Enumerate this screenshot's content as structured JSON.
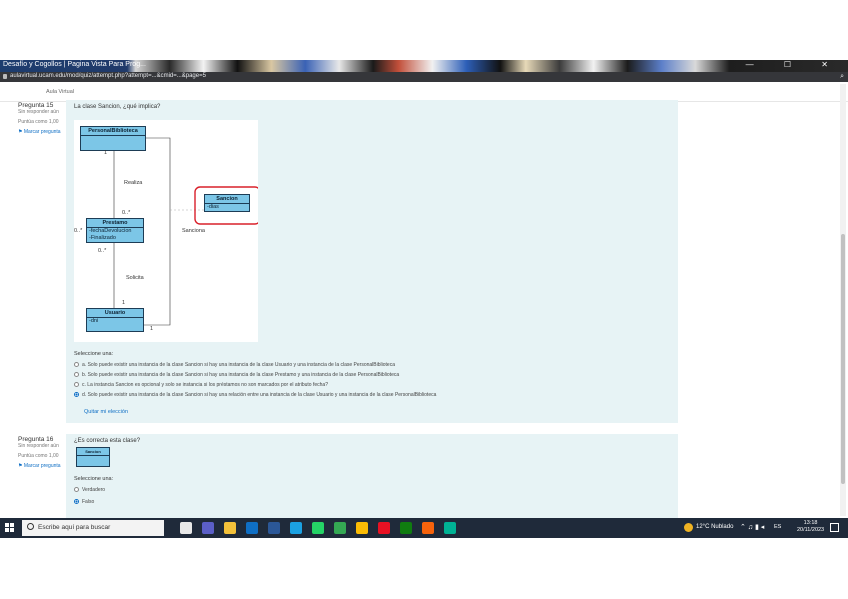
{
  "browser": {
    "tab_title": "Desafío y Cogollos | Pagina Vista Para Prog...",
    "window_controls": "— ☐ ✕",
    "url": "aulavirtual.ucam.edu/mod/quiz/attempt.php?attempt=...&cmid=...&page=5",
    "search_glyph": "⌕"
  },
  "page": {
    "header_link": "Aula Virtual"
  },
  "q15": {
    "number": "Pregunta 15",
    "status": "Sin responder aún",
    "points": "Puntúa como 1,00",
    "flag": "Marcar pregunta",
    "question": "La clase Sancion, ¿qué implica?",
    "uml": {
      "personal": {
        "title": "PersonalBiblioteca"
      },
      "prestamo": {
        "title": "Prestamo",
        "attrs": [
          "-fechaDevolucion",
          "-Finalizado"
        ]
      },
      "sancion": {
        "title": "Sancion",
        "attrs": [
          "-dias"
        ]
      },
      "usuario": {
        "title": "Usuario",
        "attrs": [
          "-dni"
        ]
      },
      "labels": {
        "realiza": "Realiza",
        "sanciona": "Sanciona",
        "solicita": "Solicita",
        "m1": "1",
        "m0n_a": "0..*",
        "m0n_b": "0..*",
        "m1_b": "1",
        "m1_c": "1",
        "m0n_c": "0..*"
      },
      "highlight_color": "#d9202a"
    },
    "select_one": "Seleccione una:",
    "options": [
      {
        "letter": "a.",
        "text": "Solo puede existir una instancia de la clase Sancion si hay una instancia de la clase Usuario y una instancia de la clase PersonalBiblioteca",
        "checked": false
      },
      {
        "letter": "b.",
        "text": "Solo puede existir una instancia de la clase Sancion si hay una instancia de la clase Prestamo y una instancia de la clase PersonalBiblioteca",
        "checked": false
      },
      {
        "letter": "c.",
        "text": "La instancia Sancion es opcional y solo se instancia si los préstamos no son marcados por el atributo fecha?",
        "checked": false
      },
      {
        "letter": "d.",
        "text": "Solo puede existir una instancia de la clase Sancion si hay una relación entre una instancia de la clase Usuario y una instancia de la clase PersonalBiblioteca",
        "checked": true
      }
    ],
    "remove_choice": "Quitar mi elección"
  },
  "q16": {
    "number": "Pregunta 16",
    "status": "Sin responder aún",
    "points": "Puntúa como 1,00",
    "flag": "Marcar pregunta",
    "question": "¿Es correcta esta clase?",
    "class_title": "Sancion",
    "select_one": "Seleccione una:",
    "options": [
      {
        "text": "Verdadero",
        "checked": false
      },
      {
        "text": "Falso",
        "checked": true
      }
    ]
  },
  "taskbar": {
    "search_placeholder": "Escribe aquí para buscar",
    "weather": "12°C Nublado",
    "tray_glyphs": "⌃ ♫ ▮ ◂",
    "lang": "ES",
    "time": "13:18",
    "date": "20/11/2023",
    "apps": [
      {
        "name": "task-view",
        "color": "#e8e8e8"
      },
      {
        "name": "teams",
        "color": "#5b5fc7"
      },
      {
        "name": "explorer",
        "color": "#f3c13a"
      },
      {
        "name": "store",
        "color": "#0f6fc5"
      },
      {
        "name": "word",
        "color": "#2b5797"
      },
      {
        "name": "edge",
        "color": "#1ba1e2"
      },
      {
        "name": "whatsapp",
        "color": "#25d366"
      },
      {
        "name": "chrome",
        "color": "#34a853"
      },
      {
        "name": "chrome-alt",
        "color": "#fbbc05"
      },
      {
        "name": "app-red",
        "color": "#e81123"
      },
      {
        "name": "app-green",
        "color": "#107c10"
      },
      {
        "name": "app-orange",
        "color": "#f7630c"
      },
      {
        "name": "app-teal",
        "color": "#00b294"
      }
    ]
  }
}
